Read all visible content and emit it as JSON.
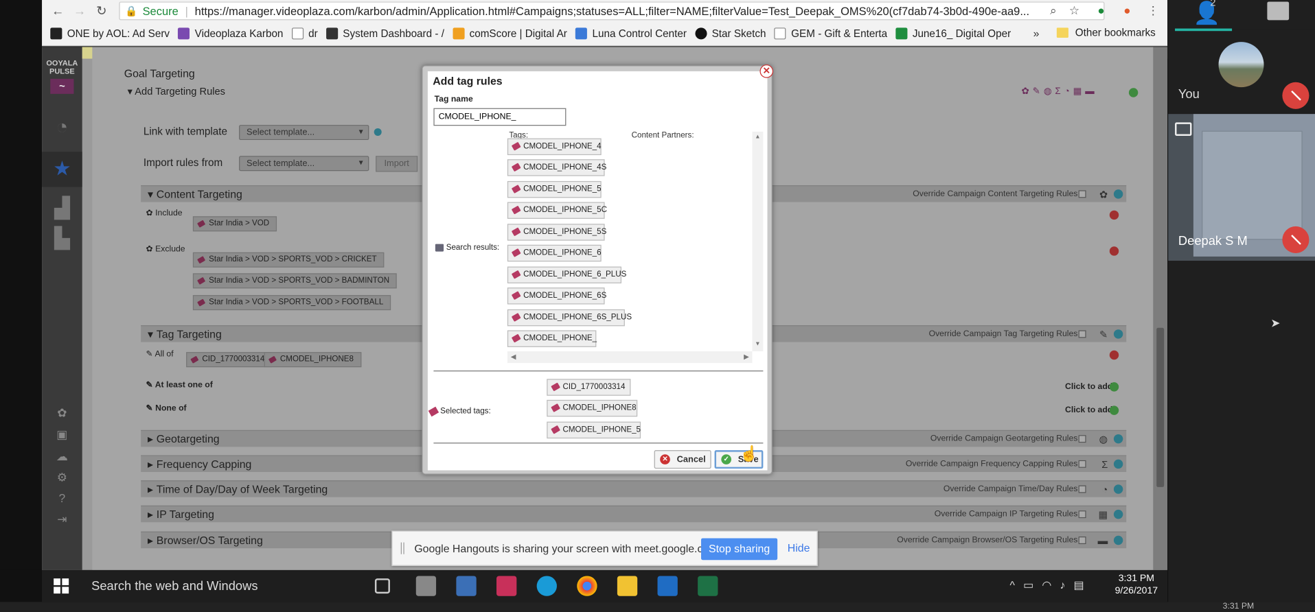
{
  "browser": {
    "secure_label": "Secure",
    "url": "https://manager.videoplaza.com/karbon/admin/Application.html#Campaigns;statuses=ALL;filter=NAME;filterValue=Test_Deepak_OMS%20(cf7dab74-3b0d-490e-aa9...",
    "bookmarks": [
      "ONE by AOL: Ad Serv",
      "Videoplaza Karbon",
      "dr",
      "System Dashboard - /",
      "comScore | Digital Ar",
      "Luna Control Center",
      "Star Sketch",
      "GEM - Gift & Enterta",
      "June16_ Digital Oper"
    ],
    "bookmarks_more": "»",
    "other_bookmarks": "Other bookmarks"
  },
  "app": {
    "logo_text": "OOYALA PULSE",
    "goal_targeting": "Goal Targeting",
    "add_targeting_rules": "Add Targeting Rules",
    "link_with_template": "Link with template",
    "import_rules_from": "Import rules from",
    "select_template": "Select template...",
    "import_button": "Import",
    "content_targeting": "Content Targeting",
    "override_content": "Override Campaign Content Targeting Rules",
    "include": "Include",
    "exclude": "Exclude",
    "include_tags": [
      "Star India > VOD"
    ],
    "exclude_tags": [
      "Star India > VOD > SPORTS_VOD > CRICKET",
      "Star India > VOD > SPORTS_VOD > BADMINTON",
      "Star India > VOD > SPORTS_VOD > FOOTBALL"
    ],
    "tag_targeting": "Tag Targeting",
    "override_tag": "Override Campaign Tag Targeting Rules",
    "all_of": "All of",
    "all_of_tags": [
      "CID_1770003314",
      "CMODEL_IPHONE8"
    ],
    "at_least_one_of": "At least one of",
    "none_of": "None of",
    "click_to_add": "Click to add",
    "sections": [
      {
        "label": "Geotargeting",
        "override": "Override Campaign Geotargeting Rules"
      },
      {
        "label": "Frequency Capping",
        "override": "Override Campaign Frequency Capping Rules"
      },
      {
        "label": "Time of Day/Day of Week Targeting",
        "override": "Override Campaign Time/Day Rules"
      },
      {
        "label": "IP Targeting",
        "override": "Override Campaign IP Targeting Rules"
      },
      {
        "label": "Browser/OS Targeting",
        "override": "Override Campaign Browser/OS Targeting Rules"
      }
    ]
  },
  "modal": {
    "title": "Add tag rules",
    "tag_name_label": "Tag name",
    "tag_name_value": "CMODEL_IPHONE_",
    "tags_header": "Tags:",
    "partners_header": "Content Partners:",
    "search_results_label": "Search results:",
    "results": [
      "CMODEL_IPHONE_4",
      "CMODEL_IPHONE_4S",
      "CMODEL_IPHONE_5",
      "CMODEL_IPHONE_5C",
      "CMODEL_IPHONE_5S",
      "CMODEL_IPHONE_6",
      "CMODEL_IPHONE_6_PLUS",
      "CMODEL_IPHONE_6S",
      "CMODEL_IPHONE_6S_PLUS",
      "CMODEL_IPHONE_"
    ],
    "selected_tags_label": "Selected tags:",
    "selected": [
      "CID_1770003314",
      "CMODEL_IPHONE8",
      "CMODEL_IPHONE_5"
    ],
    "cancel": "Cancel",
    "save": "Save"
  },
  "share_bar": {
    "message": "Google Hangouts is sharing your screen with meet.google.com.",
    "stop": "Stop sharing",
    "hide": "Hide"
  },
  "taskbar": {
    "search": "Search the web and Windows",
    "time": "3:31 PM",
    "date": "9/26/2017",
    "strip_time": "3:31 PM"
  },
  "hangouts": {
    "people_count": "2",
    "you_label": "You",
    "participant_name": "Deepak S M"
  }
}
